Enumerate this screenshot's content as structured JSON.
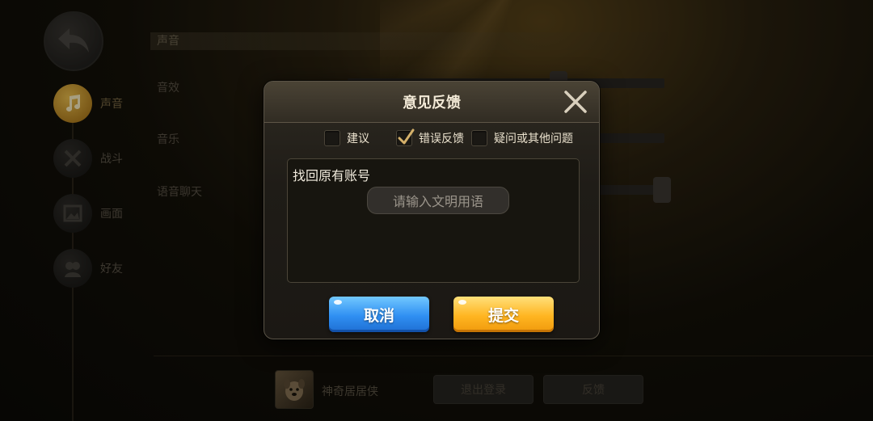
{
  "background": {
    "section_header": "声音",
    "rows": {
      "sfx": "音效",
      "music": "音乐",
      "voice_chat": "语音聊天"
    },
    "nav": [
      {
        "label": "声音",
        "icon": "music-note-icon",
        "active": true
      },
      {
        "label": "战斗",
        "icon": "crossed-swords-icon",
        "active": false
      },
      {
        "label": "画面",
        "icon": "picture-icon",
        "active": false
      },
      {
        "label": "好友",
        "icon": "friends-icon",
        "active": false
      }
    ],
    "username": "神奇居居侠",
    "logout_label": "退出登录",
    "feedback_label": "反馈"
  },
  "dialog": {
    "title": "意见反馈",
    "options": [
      {
        "label": "建议",
        "checked": false
      },
      {
        "label": "错误反馈",
        "checked": true
      },
      {
        "label": "疑问或其他问题",
        "checked": false
      }
    ],
    "input_value": "找回原有账号",
    "placeholder": "请输入文明用语",
    "cancel_label": "取消",
    "submit_label": "提交"
  },
  "colors": {
    "accent_gold": "#ffb521",
    "accent_blue": "#2f8ff2",
    "dialog_bg": "#1f1c17"
  }
}
